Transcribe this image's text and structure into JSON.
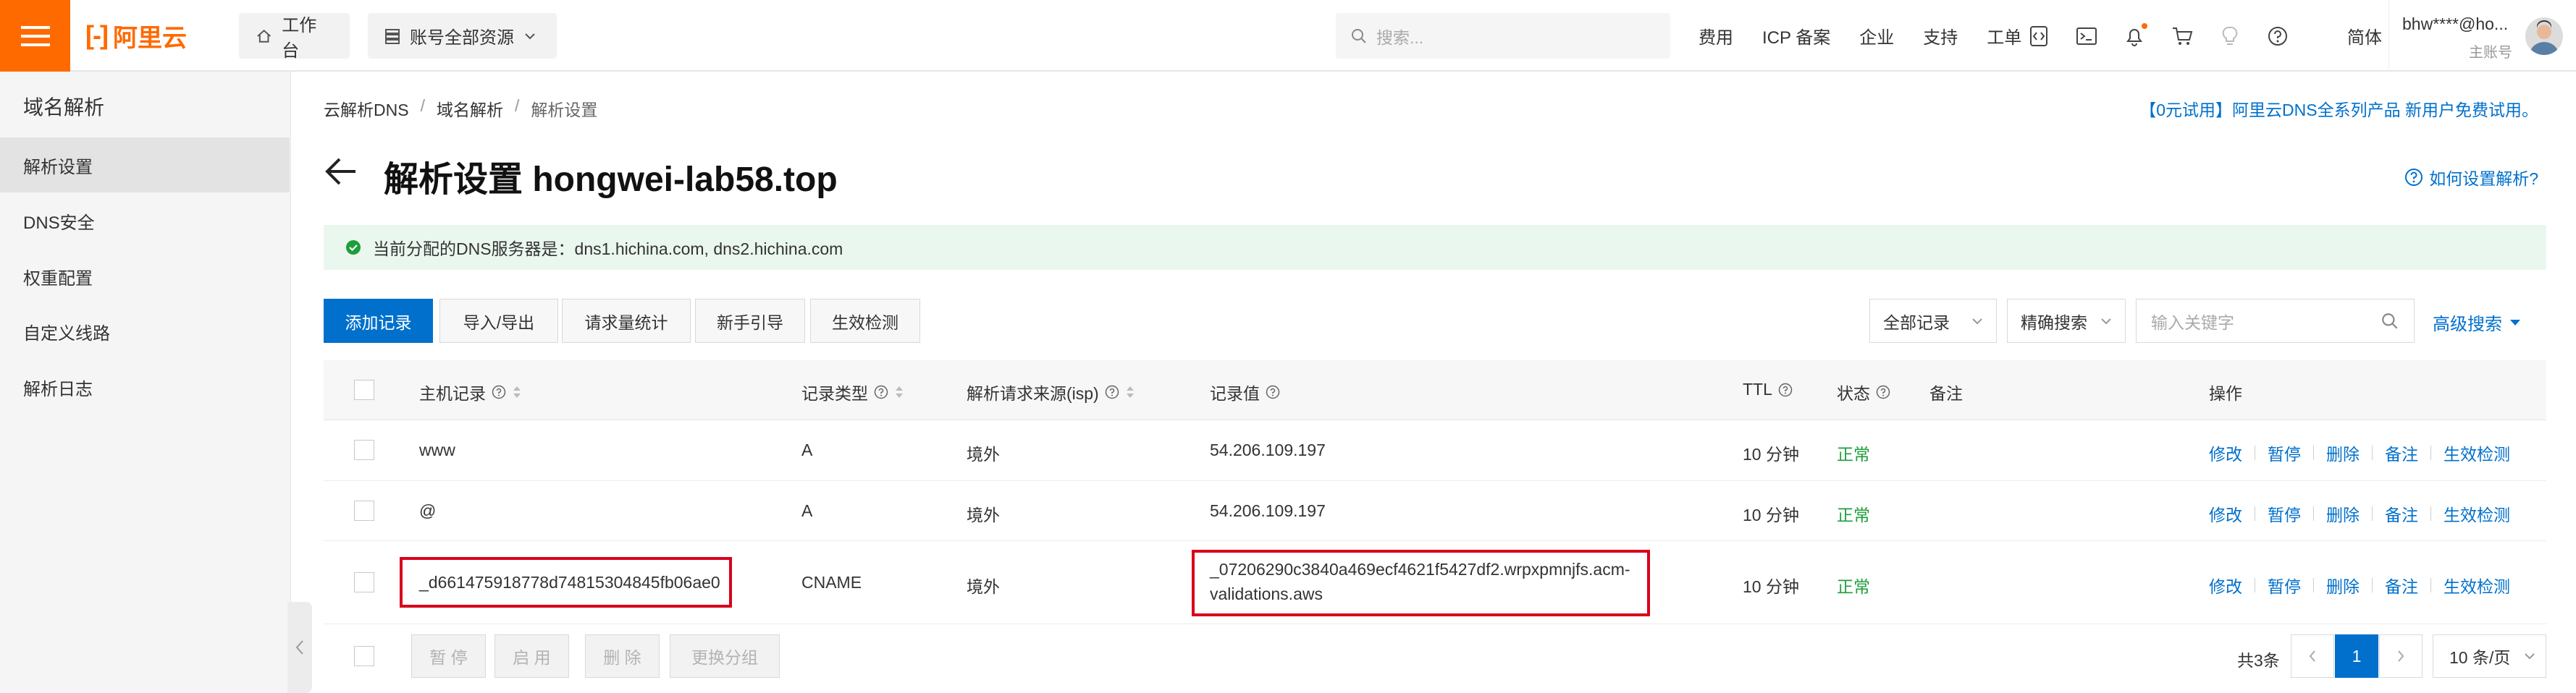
{
  "topnav": {
    "logo_text": "阿里云",
    "workbench": "工作台",
    "resources": "账号全部资源",
    "search_placeholder": "搜索...",
    "links": [
      "费用",
      "ICP 备案",
      "企业",
      "支持",
      "工单"
    ],
    "lang": "简体",
    "account_email": "bhw****@ho...",
    "account_role": "主账号",
    "brand_color": "#ff6a00"
  },
  "sidebar": {
    "title": "域名解析",
    "items": [
      "解析设置",
      "DNS安全",
      "权重配置",
      "自定义线路",
      "解析日志"
    ]
  },
  "breadcrumb": [
    "云解析DNS",
    "域名解析",
    "解析设置"
  ],
  "promo": "【0元试用】阿里云DNS全系列产品 新用户免费试用。",
  "page_title": "解析设置 hongwei-lab58.top",
  "howto": "如何设置解析?",
  "alert": "当前分配的DNS服务器是：dns1.hichina.com, dns2.hichina.com",
  "toolbar": {
    "add": "添加记录",
    "import": "导入/导出",
    "stats": "请求量统计",
    "guide": "新手引导",
    "check": "生效检测",
    "filter_all": "全部记录",
    "precise": "精确搜索",
    "keyword_placeholder": "输入关键字",
    "advanced": "高级搜索"
  },
  "table": {
    "headers": {
      "host": "主机记录",
      "type": "记录类型",
      "isp": "解析请求来源(isp)",
      "value": "记录值",
      "ttl": "TTL",
      "status": "状态",
      "remark": "备注",
      "ops": "操作"
    },
    "rows": [
      {
        "host": "www",
        "type": "A",
        "isp": "境外",
        "value1": "54.206.109.197",
        "value2": "",
        "ttl": "10 分钟",
        "status": "正常"
      },
      {
        "host": "@",
        "type": "A",
        "isp": "境外",
        "value1": "54.206.109.197",
        "value2": "",
        "ttl": "10 分钟",
        "status": "正常"
      },
      {
        "host": "_d661475918778d74815304845fb06ae0",
        "type": "CNAME",
        "isp": "境外",
        "value1": "_07206290c3840a469ecf4621f5427df2.wrpxpmnjfs.acm-",
        "value2": "validations.aws",
        "ttl": "10 分钟",
        "status": "正常"
      }
    ],
    "ops": [
      "修改",
      "暂停",
      "删除",
      "备注",
      "生效检测"
    ]
  },
  "bulk": {
    "pause": "暂 停",
    "enable": "启 用",
    "delete": "删 除",
    "group": "更换分组"
  },
  "pagination": {
    "total": "共3条",
    "current": "1",
    "page_size": "10 条/页"
  }
}
